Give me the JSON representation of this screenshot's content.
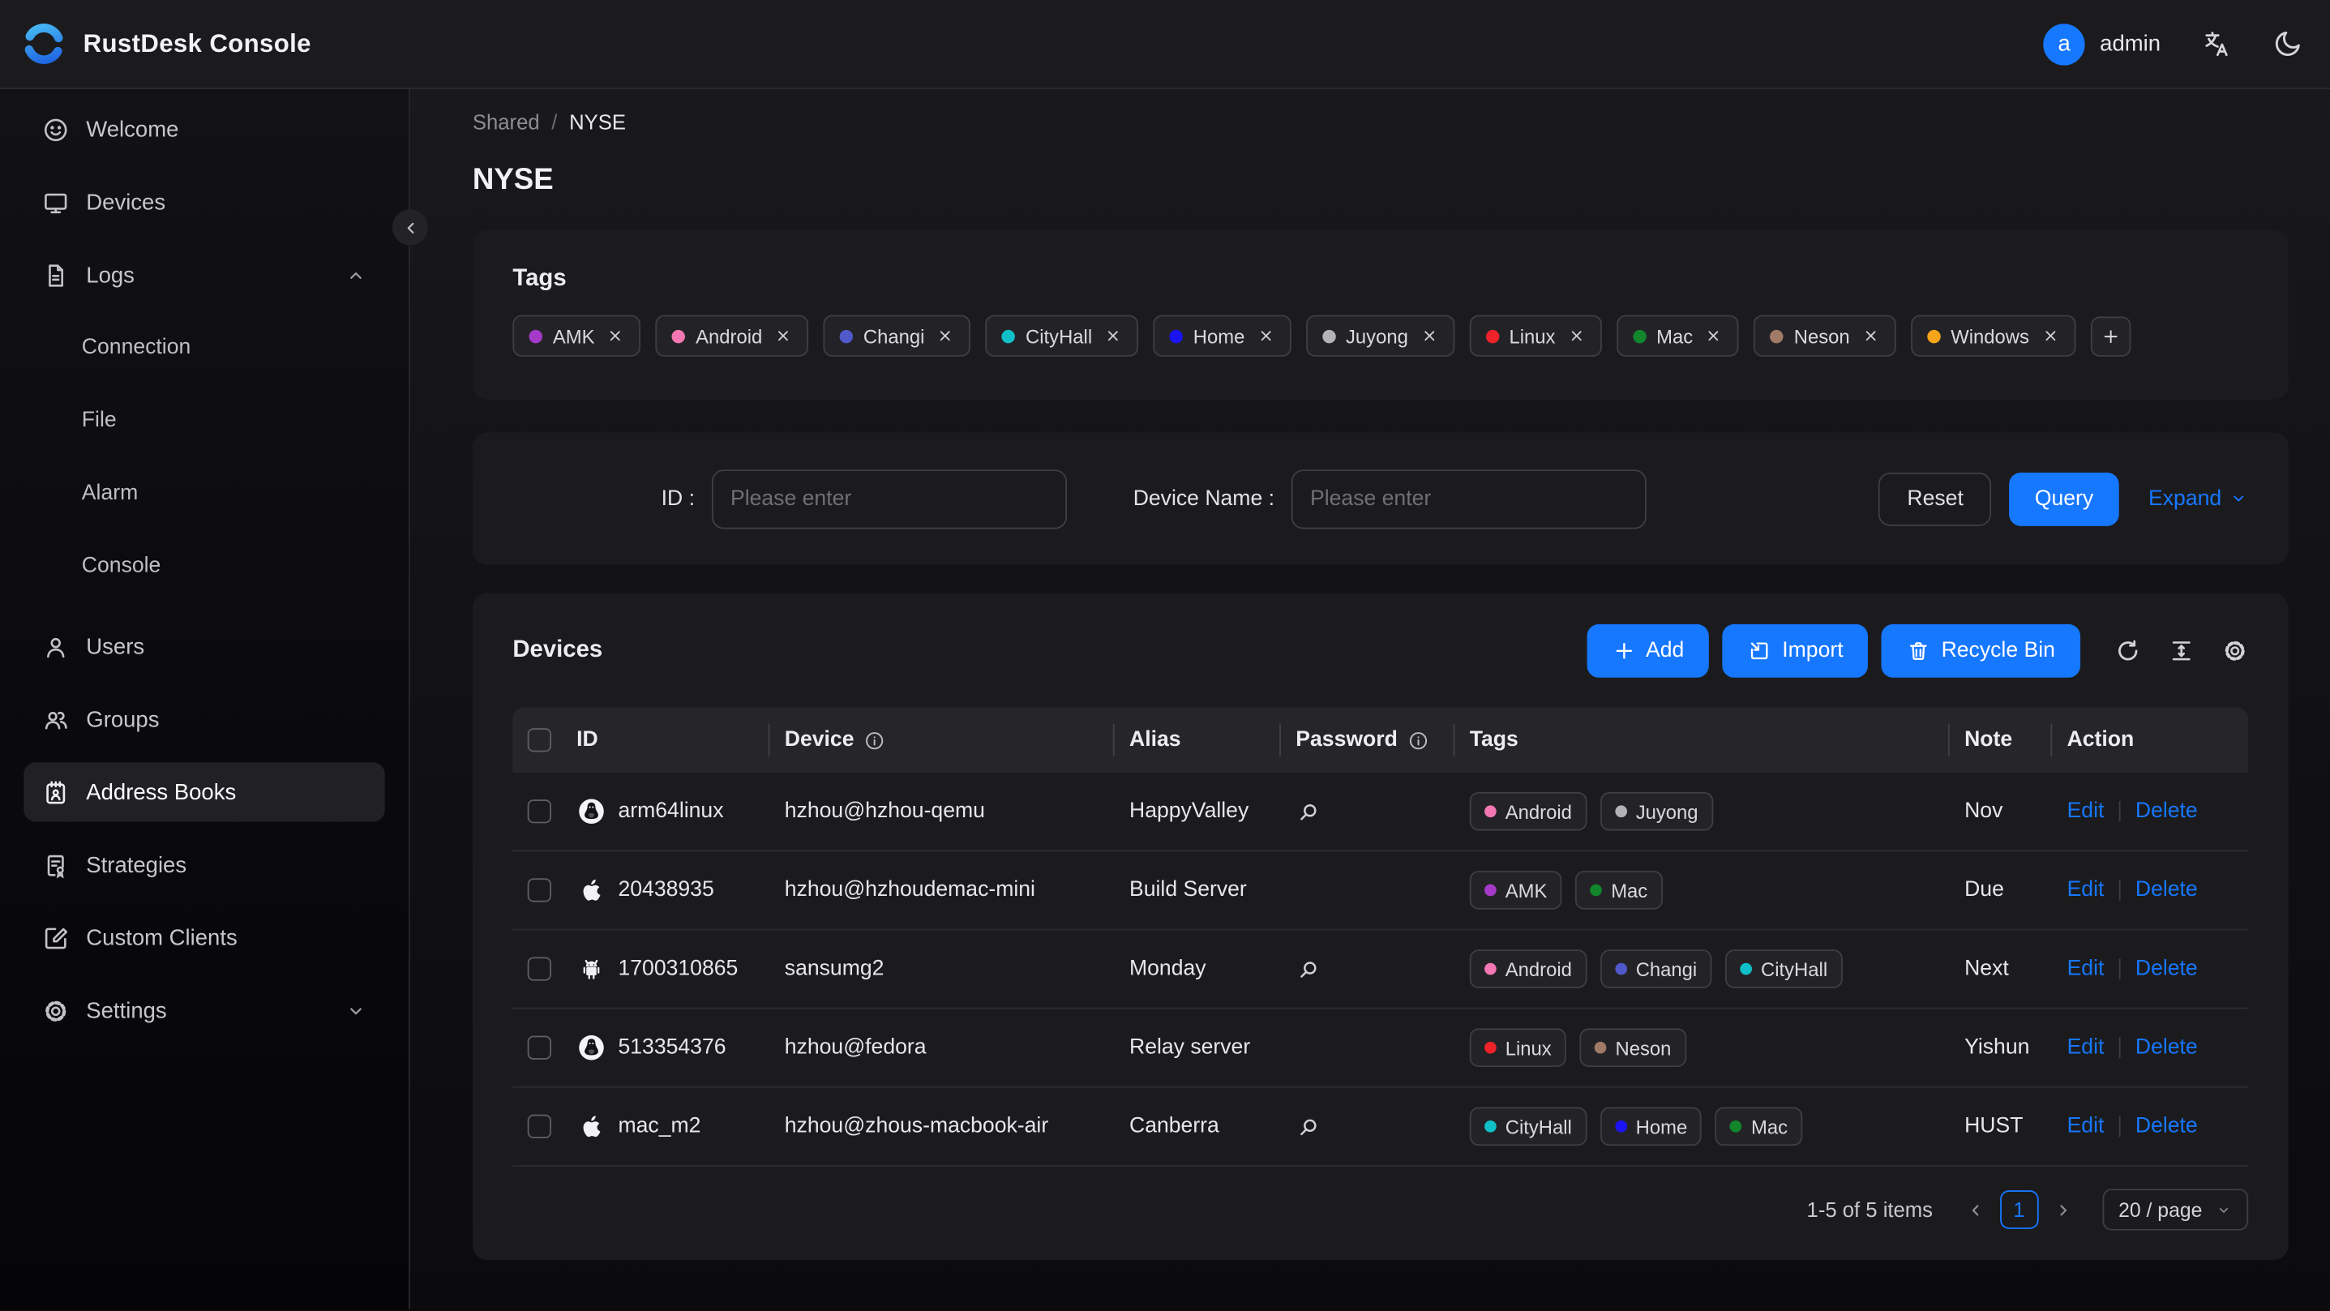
{
  "accent_color": "#1677ff",
  "topbar": {
    "title": "RustDesk Console",
    "user": {
      "initial": "a",
      "name": "admin"
    },
    "icons": [
      "translate-icon",
      "moon-icon"
    ]
  },
  "sidebar": {
    "items": [
      {
        "label": "Welcome",
        "icon": "smiley"
      },
      {
        "label": "Devices",
        "icon": "monitor"
      },
      {
        "label": "Logs",
        "icon": "file-text",
        "chevron": "up"
      },
      {
        "label": "Connection",
        "sub": true
      },
      {
        "label": "File",
        "sub": true
      },
      {
        "label": "Alarm",
        "sub": true
      },
      {
        "label": "Console",
        "sub": true
      },
      {
        "label": "Users",
        "icon": "user",
        "gap": true
      },
      {
        "label": "Groups",
        "icon": "users"
      },
      {
        "label": "Address Books",
        "icon": "address-book",
        "active": true
      },
      {
        "label": "Strategies",
        "icon": "strategy"
      },
      {
        "label": "Custom Clients",
        "icon": "edit-square"
      },
      {
        "label": "Settings",
        "icon": "gear",
        "chevron": "down"
      }
    ]
  },
  "breadcrumb": {
    "parent": "Shared",
    "separator": "/",
    "current": "NYSE"
  },
  "page_title": "NYSE",
  "tags_card": {
    "title": "Tags",
    "tags": [
      {
        "label": "AMK",
        "color": "#a63ac8"
      },
      {
        "label": "Android",
        "color": "#f377b3"
      },
      {
        "label": "Changi",
        "color": "#5059c9"
      },
      {
        "label": "CityHall",
        "color": "#10c0c9"
      },
      {
        "label": "Home",
        "color": "#1b13f2"
      },
      {
        "label": "Juyong",
        "color": "#b3b3b6"
      },
      {
        "label": "Linux",
        "color": "#ee2228"
      },
      {
        "label": "Mac",
        "color": "#12862b"
      },
      {
        "label": "Neson",
        "color": "#a17a68"
      },
      {
        "label": "Windows",
        "color": "#f6a418"
      }
    ],
    "add_button": "+"
  },
  "filter": {
    "id_label": "ID :",
    "id_placeholder": "Please enter",
    "device_name_label": "Device Name :",
    "device_name_placeholder": "Please enter",
    "reset_label": "Reset",
    "query_label": "Query",
    "expand_label": "Expand"
  },
  "devices_card": {
    "title": "Devices",
    "add_label": "Add",
    "import_label": "Import",
    "recycle_bin_label": "Recycle Bin",
    "table": {
      "headers": {
        "id": "ID",
        "device": "Device",
        "alias": "Alias",
        "password": "Password",
        "tags": "Tags",
        "note": "Note",
        "action": "Action"
      },
      "rows": [
        {
          "os": "linux",
          "id": "arm64linux",
          "device": "hzhou@hzhou-qemu",
          "alias": "HappyValley",
          "has_password": true,
          "tags": [
            "Android",
            "Juyong"
          ],
          "note": "Nov"
        },
        {
          "os": "apple",
          "id": "20438935",
          "device": "hzhou@hzhoudemac-mini",
          "alias": "Build Server",
          "has_password": false,
          "tags": [
            "AMK",
            "Mac"
          ],
          "note": "Due"
        },
        {
          "os": "android",
          "id": "1700310865",
          "device": "sansumg2",
          "alias": "Monday",
          "has_password": true,
          "tags": [
            "Android",
            "Changi",
            "CityHall"
          ],
          "note": "Next"
        },
        {
          "os": "linux",
          "id": "513354376",
          "device": "hzhou@fedora",
          "alias": "Relay server",
          "has_password": false,
          "tags": [
            "Linux",
            "Neson"
          ],
          "note": "Yishun"
        },
        {
          "os": "apple",
          "id": "mac_m2",
          "device": "hzhou@zhous-macbook-air",
          "alias": "Canberra",
          "has_password": true,
          "tags": [
            "CityHall",
            "Home",
            "Mac"
          ],
          "note": "HUST"
        }
      ],
      "edit_label": "Edit",
      "delete_label": "Delete"
    },
    "pagination": {
      "summary": "1-5 of 5 items",
      "current_page": "1",
      "page_size": "20 / page"
    }
  }
}
